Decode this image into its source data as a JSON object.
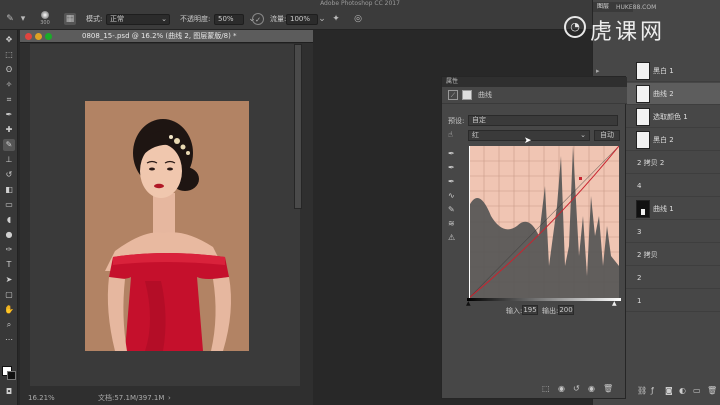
{
  "app": {
    "title": "Adobe Photoshop CC 2017"
  },
  "options_bar": {
    "brush_size": "300",
    "mode_label": "模式:",
    "mode_value": "正常",
    "opacity_label": "不透明度:",
    "opacity_value": "50%",
    "flow_label": "流量:",
    "flow_value": "100%"
  },
  "document": {
    "tab_title": "0808_15-.psd @ 16.2% (曲线 2, 图层蒙版/8) *",
    "zoom": "16.21%",
    "doc_size": "文档:57.1M/397.1M"
  },
  "properties": {
    "panel_title": "属性",
    "adjust_label": "曲线",
    "preset_label": "预设:",
    "preset_value": "自定",
    "channel_value": "红",
    "auto_button": "自动",
    "input_label": "输入:",
    "input_value": "195",
    "output_label": "输出:",
    "output_value": "200"
  },
  "layers_panel": {
    "tab_label": "图层",
    "layers": [
      {
        "name": "黑白 1",
        "selected": false,
        "thumb": "white"
      },
      {
        "name": "曲线 2",
        "selected": true,
        "thumb": "white"
      },
      {
        "name": "选取颜色 1",
        "selected": false,
        "thumb": "white"
      },
      {
        "name": "黑白 2",
        "selected": false,
        "thumb": "white"
      },
      {
        "name": "2 拷贝 2",
        "selected": false,
        "thumb": "none"
      },
      {
        "name": "4",
        "selected": false,
        "thumb": "none"
      },
      {
        "name": "曲线 1",
        "selected": false,
        "thumb": "black"
      },
      {
        "name": "3",
        "selected": false,
        "thumb": "none"
      },
      {
        "name": "2 拷贝",
        "selected": false,
        "thumb": "none"
      },
      {
        "name": "2",
        "selected": false,
        "thumb": "none"
      },
      {
        "name": "1",
        "selected": false,
        "thumb": "none"
      }
    ]
  },
  "watermark": {
    "text": "虎课网",
    "sub": "HUKE88.COM"
  },
  "colors": {
    "accent": "#2d6dd0",
    "dress": "#c8102e",
    "backdrop": "#b8876a"
  },
  "icons": [
    "brush-icon",
    "move-icon",
    "marquee-icon",
    "lasso-icon",
    "wand-icon",
    "crop-icon",
    "eyedropper-icon",
    "heal-icon",
    "brush-tool-icon",
    "stamp-icon",
    "history-icon",
    "eraser-icon",
    "gradient-icon",
    "blur-icon",
    "dodge-icon",
    "pen-icon",
    "type-icon",
    "path-icon",
    "shape-icon",
    "hand-icon",
    "zoom-icon"
  ]
}
